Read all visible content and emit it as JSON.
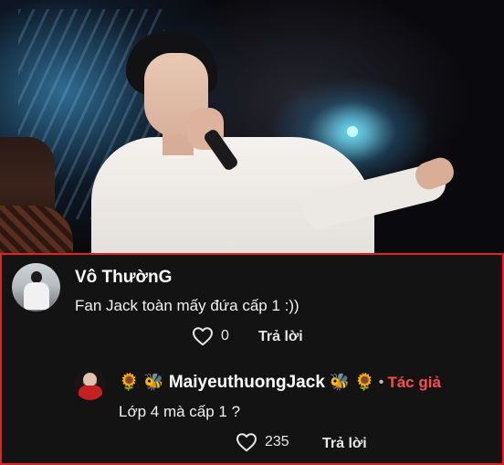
{
  "photo": {
    "description_icon": "concert-photo"
  },
  "comments": [
    {
      "username": "Vô ThườnG",
      "text": "Fan Jack toàn mấy đứa cấp 1 :))",
      "likes": "0",
      "reply_label": "Trả lời"
    }
  ],
  "reply": {
    "emoji_left": [
      "🌻",
      "🐝"
    ],
    "username": "MaiyeuthuongJack",
    "emoji_right": [
      "🐝",
      "🌻"
    ],
    "separator": "•",
    "author_badge": "Tác giả",
    "text": "Lớp 4 mà cấp 1 ?",
    "likes": "235",
    "reply_label": "Trả lời"
  },
  "colors": {
    "panel_background": "#131313",
    "panel_border": "#e0241d",
    "author_badge": "#ff4b4b",
    "text": "#ffffff"
  },
  "icons": [
    "heart-outline-icon"
  ]
}
